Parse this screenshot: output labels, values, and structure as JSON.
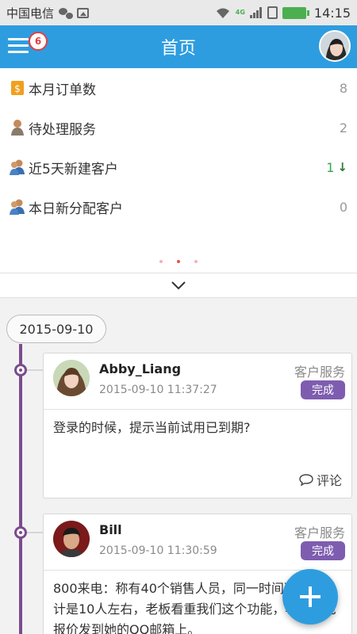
{
  "status_bar": {
    "carrier": "中国电信",
    "network": "4G",
    "time": "14:15",
    "icons": [
      "wechat-icon",
      "image-icon",
      "wifi-icon",
      "signal-icon",
      "sim-icon",
      "battery-icon"
    ]
  },
  "header": {
    "title": "首页",
    "menu_badge": "6",
    "accent_color": "#2d9de0"
  },
  "stats": [
    {
      "label": "本月订单数",
      "value": "8",
      "icon": "order-icon"
    },
    {
      "label": "待处理服务",
      "value": "2",
      "icon": "user-icon"
    },
    {
      "label": "近5天新建客户",
      "value": "1",
      "icon": "users-icon",
      "trend": "↓"
    },
    {
      "label": "本日新分配客户",
      "value": "0",
      "icon": "users-icon"
    }
  ],
  "pager": {
    "pages": 3,
    "active": 2
  },
  "timeline": {
    "date": "2015-09-10",
    "line_color": "#7b4b8e",
    "status_color": "#7e5db0",
    "cards": [
      {
        "name": "Abby_Liang",
        "time": "2015-09-10 11:37:27",
        "type": "客户服务",
        "status": "完成",
        "content": "登录的时候，提示当前试用已到期?",
        "comment_label": "评论"
      },
      {
        "name": "Bill",
        "time": "2015-09-10 11:30:59",
        "type": "客户服务",
        "status": "完成",
        "content": "800来电：称有40个销售人员，同一时间决定，预计是10人左右，老板看重我们这个功能，希望能把报价发到她的QQ邮箱上。"
      }
    ]
  }
}
